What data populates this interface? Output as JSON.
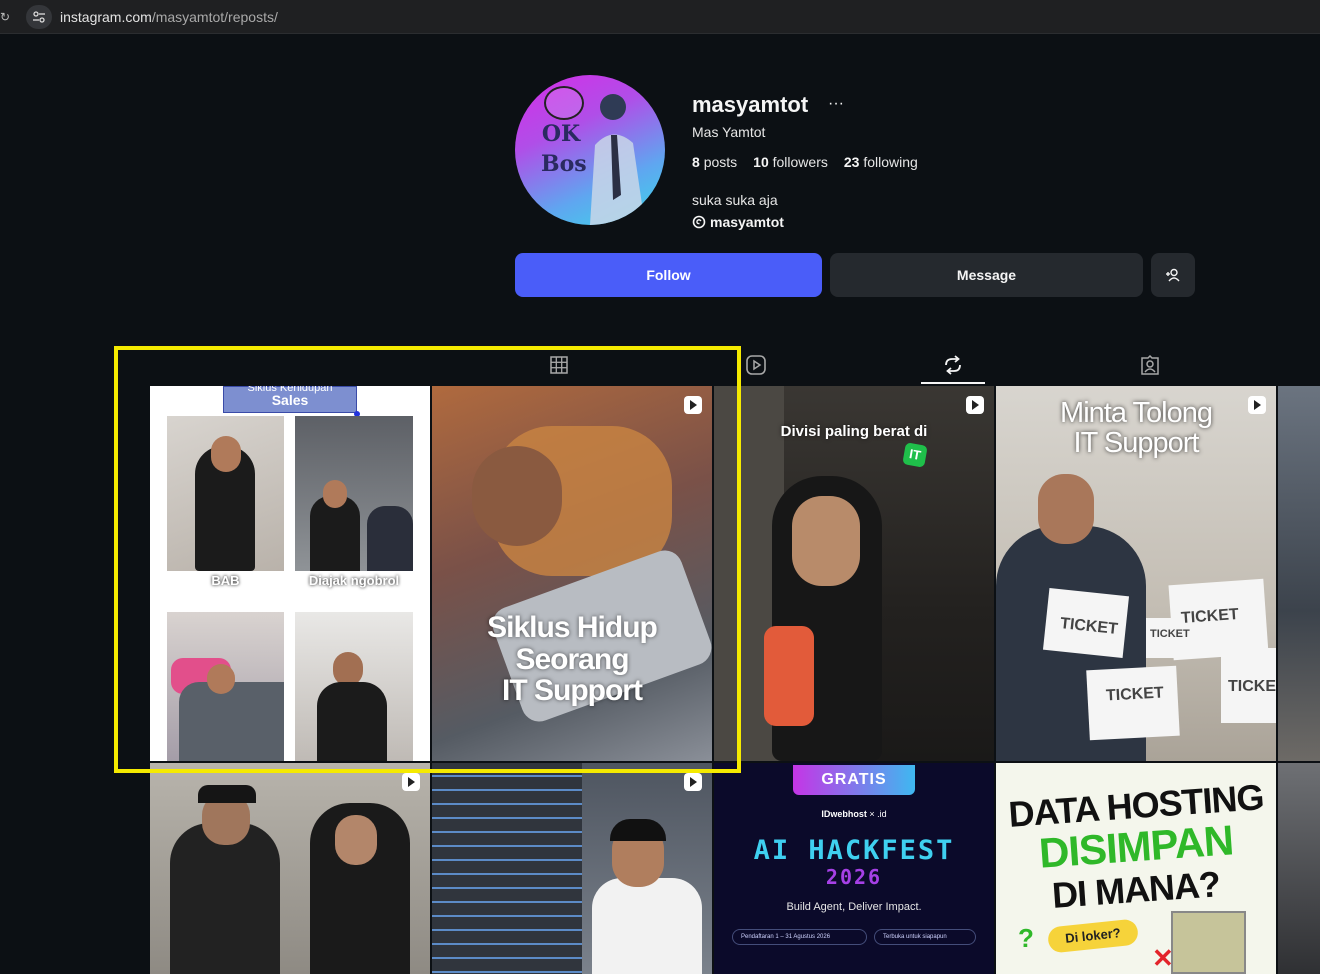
{
  "browser": {
    "url_host": "instagram.com",
    "url_path": "/masyamtot/reposts/"
  },
  "profile": {
    "avatar_text_1": "OK",
    "avatar_text_2": "Bos",
    "username": "masyamtot",
    "more_label": "···",
    "full_name": "Mas Yamtot",
    "posts_count": "8",
    "posts_label": "posts",
    "followers_count": "10",
    "followers_label": "followers",
    "following_count": "23",
    "following_label": "following",
    "bio": "suka suka aja",
    "threads_handle": "masyamtot"
  },
  "actions": {
    "follow_label": "Follow",
    "message_label": "Message",
    "suggest_icon": "add-person-icon"
  },
  "tabs": [
    {
      "name": "posts",
      "icon": "grid-icon",
      "active": false
    },
    {
      "name": "reels",
      "icon": "reels-icon",
      "active": false
    },
    {
      "name": "reposts",
      "icon": "repost-icon",
      "active": true
    },
    {
      "name": "tagged",
      "icon": "tagged-icon",
      "active": false
    }
  ],
  "posts": [
    {
      "title_top": "Siklus Kehidupan",
      "title_sub": "Sales",
      "labels": [
        "BAB",
        "Diajak ngobrol"
      ]
    },
    {
      "caption_lines": [
        "Siklus Hidup",
        "Seorang",
        "IT Support"
      ]
    },
    {
      "caption": "Divisi paling berat di",
      "tag": "IT"
    },
    {
      "caption_lines": [
        "Minta Tolong",
        "IT Support"
      ],
      "props": [
        "TICKET",
        "TICKET",
        "TICKET",
        "TICKET",
        "TICKET"
      ]
    },
    {},
    {},
    {
      "badge": "GRATIS",
      "brand": "IDwebhost",
      "brand_suffix": ".id",
      "cross": "×",
      "title_1": "AI HACKFEST",
      "title_2": "2026",
      "tagline": "Build Agent, Deliver Impact.",
      "date": "Pendaftaran 1 – 31 Agustus 2026",
      "note": "Terbuka untuk siapapun"
    },
    {
      "lines": [
        "DATA HOSTING",
        "DISIMPAN",
        "DI MANA?"
      ],
      "bubble": "Di loker?"
    }
  ]
}
